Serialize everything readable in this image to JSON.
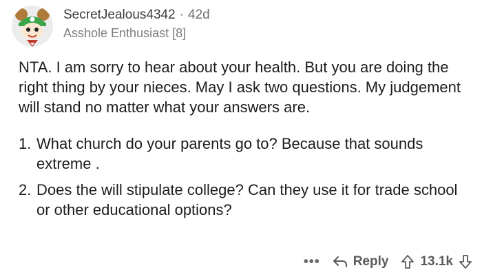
{
  "comment": {
    "username": "SecretJealous4342",
    "separator": "·",
    "age": "42d",
    "flair": "Asshole Enthusiast [8]",
    "paragraph": "NTA.  I am sorry to hear about your health.  But you are doing the right thing by your nieces. May I ask two questions.  My judgement will stand no matter what your answers are.",
    "list": [
      {
        "number": "1.",
        "text": "What church do your parents go to? Because that sounds extreme ."
      },
      {
        "number": "2.",
        "text": "Does the will stipulate college? Can they use it for trade school or other educational options?"
      }
    ],
    "actions": {
      "more_label": "•••",
      "reply_label": "Reply",
      "vote_count": "13.1k"
    }
  },
  "icons": {
    "avatar": "reddit-avatar-icon",
    "more": "more-options-icon",
    "reply": "reply-arrow-icon",
    "upvote": "upvote-arrow-icon",
    "downvote": "downvote-arrow-icon"
  }
}
